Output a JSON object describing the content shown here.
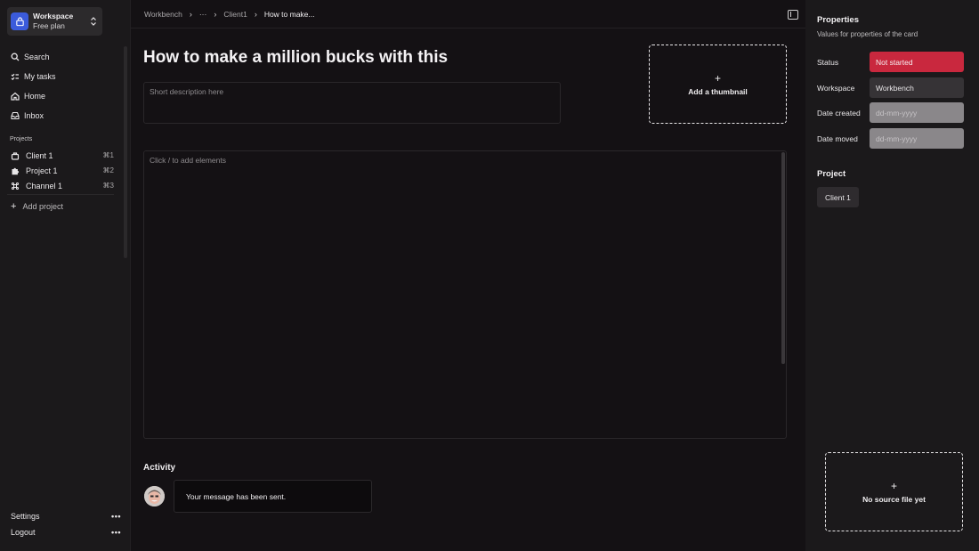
{
  "workspace": {
    "name": "Workspace",
    "plan": "Free plan"
  },
  "nav": [
    {
      "label": "Search",
      "icon": "search-icon"
    },
    {
      "label": "My tasks",
      "icon": "tasks-icon"
    },
    {
      "label": "Home",
      "icon": "home-icon"
    },
    {
      "label": "Inbox",
      "icon": "inbox-icon"
    }
  ],
  "projects_label": "Projects",
  "projects": [
    {
      "label": "Client 1",
      "shortcut": "⌘1",
      "icon": "briefcase-icon"
    },
    {
      "label": "Project 1",
      "shortcut": "⌘2",
      "icon": "puzzle-icon"
    },
    {
      "label": "Channel 1",
      "shortcut": "⌘3",
      "icon": "command-icon"
    }
  ],
  "add_project": "Add project",
  "bottom": {
    "settings": "Settings",
    "logout": "Logout",
    "more": "•••"
  },
  "breadcrumb": {
    "root": "Workbench",
    "ellipsis": "···",
    "parent": "Client1",
    "current": "How to make..."
  },
  "card": {
    "title": "How to make a million bucks with this",
    "description_placeholder": "Short description here",
    "thumbnail_label": "Add a thumbnail",
    "editor_placeholder": "Click / to add elements"
  },
  "activity": {
    "heading": "Activity",
    "message": "Your message has been sent."
  },
  "properties": {
    "title": "Properties",
    "subtitle": "Values for properties of the card",
    "status_label": "Status",
    "status_value": "Not started",
    "workspace_label": "Workspace",
    "workspace_value": "Workbench",
    "date_created_label": "Date created",
    "date_created_value": "dd-mm-yyyy",
    "date_moved_label": "Date moved",
    "date_moved_value": "dd-mm-yyyy",
    "project_heading": "Project",
    "project_value": "Client 1",
    "source_file_label": "No source file yet"
  },
  "colors": {
    "accent": "#3b5bdb",
    "status_red": "#c9283e",
    "background": "#141114",
    "panel": "#1b191b"
  }
}
